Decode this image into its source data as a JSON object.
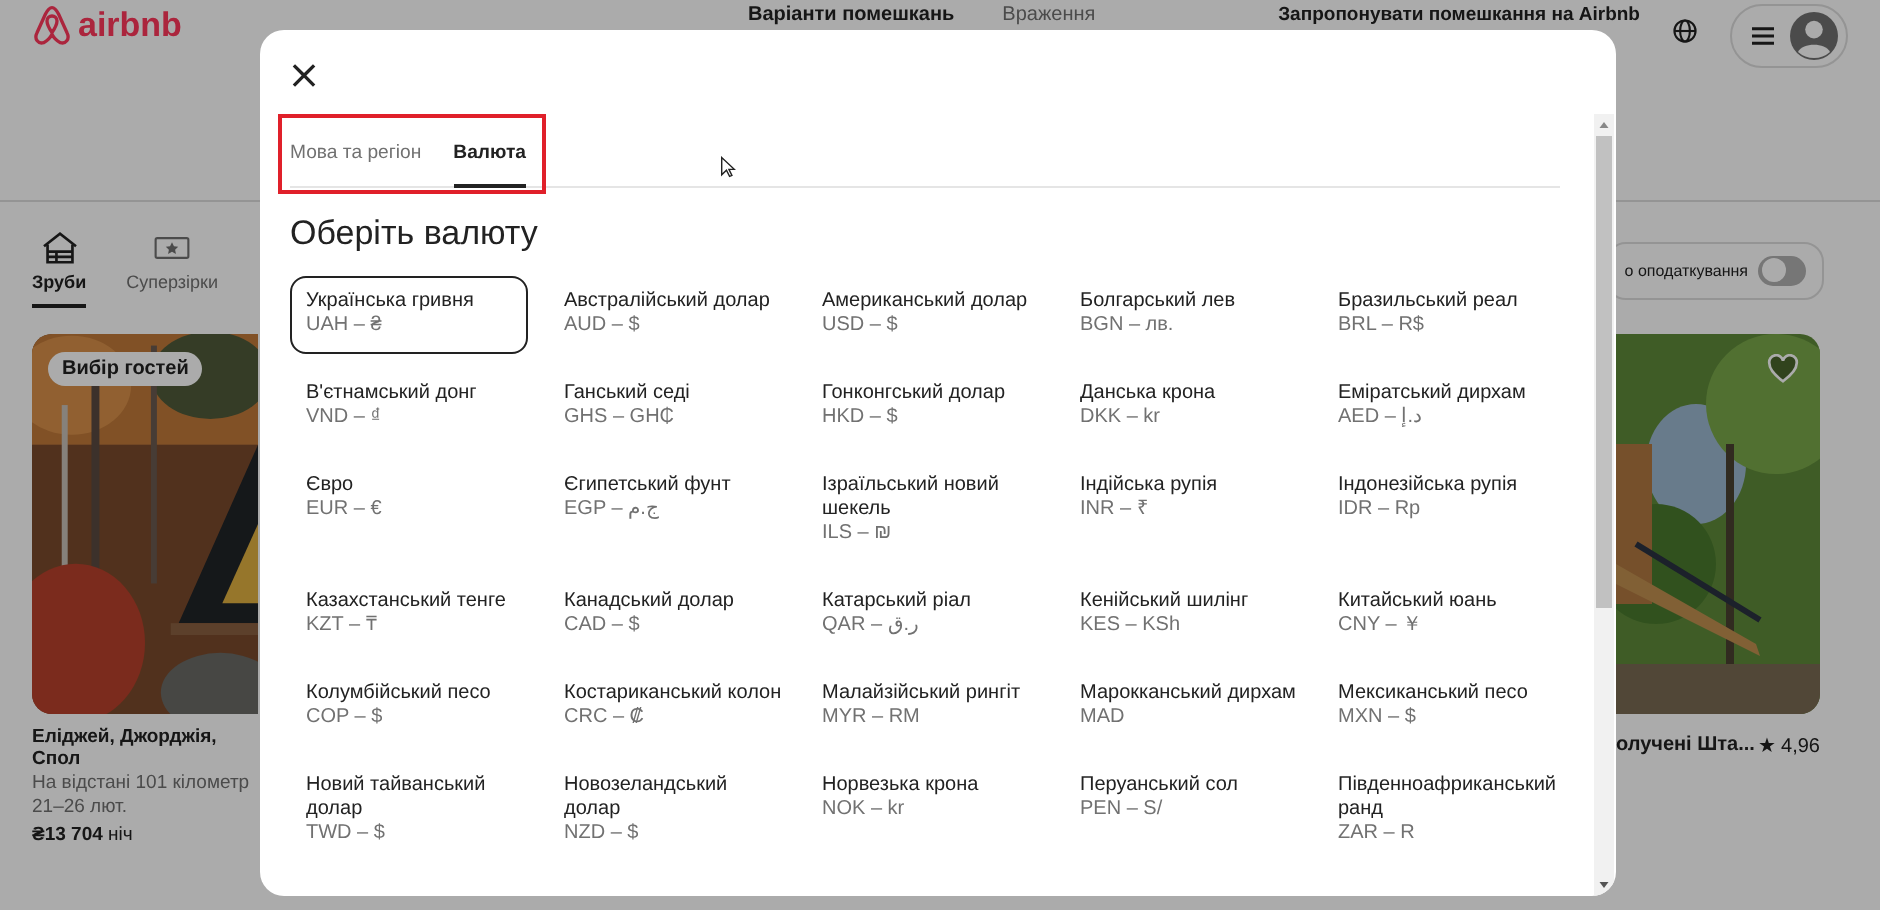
{
  "header": {
    "logo": "airbnb",
    "nav": [
      {
        "label": "Варіанти помешкань",
        "selected": true
      },
      {
        "label": "Враження",
        "selected": false
      }
    ],
    "host_link": "Запропонувати помешкання на Airbnb"
  },
  "categories": [
    {
      "label": "Зруби",
      "selected": true,
      "kind": "cabin"
    },
    {
      "label": "Суперзірки",
      "selected": false,
      "kind": "star"
    }
  ],
  "tax_toggle": {
    "label": "о оподаткування",
    "on": false
  },
  "listings": [
    {
      "badge": "Вибір гостей",
      "title": "Еліджей, Джорджія, Спол",
      "distance": "На відстані 101 кілометр",
      "dates": "21–26 лют.",
      "price": "**₴13 704** ніч",
      "kind": "autumn"
    },
    {
      "title": "олучені Шта...",
      "rating": "★ 4,96",
      "kind": "green"
    }
  ],
  "modal": {
    "close": "×",
    "tabs": [
      {
        "label": "Мова та регіон",
        "selected": false
      },
      {
        "label": "Валюта",
        "selected": true
      }
    ],
    "heading": "Оберіть валюту",
    "currencies": [
      {
        "name": "Українська гривня",
        "code": "UAH – ₴",
        "selected": true
      },
      {
        "name": "Австралійський долар",
        "code": "AUD – $",
        "selected": false
      },
      {
        "name": "Американський долар",
        "code": "USD – $",
        "selected": false
      },
      {
        "name": "Болгарський лев",
        "code": "BGN – лв.",
        "selected": false
      },
      {
        "name": "Бразильський реал",
        "code": "BRL – R$",
        "selected": false
      },
      {
        "name": "В'єтнамський донг",
        "code": "VND – ₫",
        "selected": false
      },
      {
        "name": "Ганський седі",
        "code": "GHS – GH₵",
        "selected": false
      },
      {
        "name": "Гонконгський долар",
        "code": "HKD – $",
        "selected": false
      },
      {
        "name": "Данська крона",
        "code": "DKK – kr",
        "selected": false
      },
      {
        "name": "Еміратський дирхам",
        "code": "AED – د.إ",
        "selected": false
      },
      {
        "name": "Євро",
        "code": "EUR – €",
        "selected": false
      },
      {
        "name": "Єгипетський фунт",
        "code": "EGP – ج.م",
        "selected": false
      },
      {
        "name": "Ізраїльський новий шекель",
        "code": "ILS – ₪",
        "selected": false
      },
      {
        "name": "Індійська рупія",
        "code": "INR – ₹",
        "selected": false
      },
      {
        "name": "Індонезійська рупія",
        "code": "IDR – Rp",
        "selected": false
      },
      {
        "name": "Казахстанський тенге",
        "code": "KZT – ₸",
        "selected": false
      },
      {
        "name": "Канадський долар",
        "code": "CAD – $",
        "selected": false
      },
      {
        "name": "Катарський ріал",
        "code": "QAR – ر.ق",
        "selected": false
      },
      {
        "name": "Кенійський шилінг",
        "code": "KES – KSh",
        "selected": false
      },
      {
        "name": "Китайський юань",
        "code": "CNY – ￥",
        "selected": false
      },
      {
        "name": "Колумбійський песо",
        "code": "COP – $",
        "selected": false
      },
      {
        "name": "Костариканський колон",
        "code": "CRC – ₡",
        "selected": false
      },
      {
        "name": "Малайзійський рингіт",
        "code": "MYR – RM",
        "selected": false
      },
      {
        "name": "Марокканський дирхам",
        "code": "MAD",
        "selected": false
      },
      {
        "name": "Мексиканський песо",
        "code": "MXN – $",
        "selected": false
      },
      {
        "name": "Новий тайванський долар",
        "code": "TWD – $",
        "selected": false
      },
      {
        "name": "Новозеландський долар",
        "code": "NZD – $",
        "selected": false
      },
      {
        "name": "Норвезька крона",
        "code": "NOK – kr",
        "selected": false
      },
      {
        "name": "Перуанський сол",
        "code": "PEN – S/",
        "selected": false
      },
      {
        "name": "Південноафриканський ранд",
        "code": "ZAR – R",
        "selected": false
      }
    ]
  }
}
